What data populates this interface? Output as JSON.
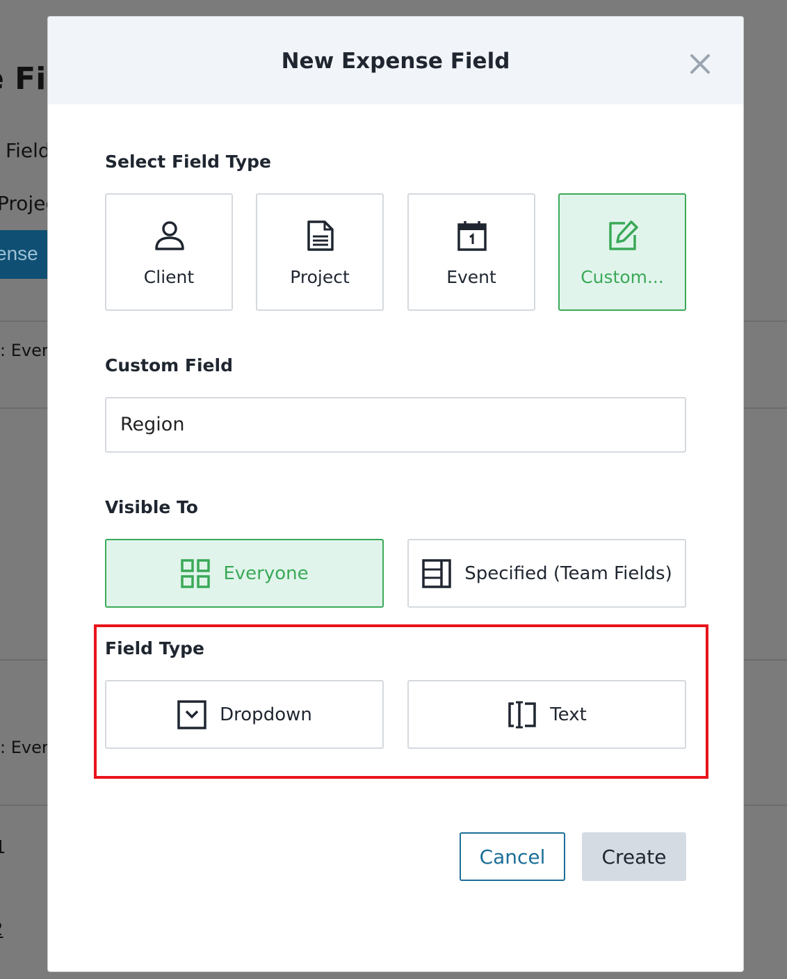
{
  "background": {
    "title_fragment": "e Fie",
    "field_fragment": "Field",
    "project_fragment": "Projec",
    "button_fragment": "ense",
    "every_fragment_1": ": Every",
    "every_fragment_2": ": Every",
    "num_1": "1",
    "num_2": "2"
  },
  "modal": {
    "title": "New Expense Field",
    "select_field_type_label": "Select Field Type",
    "field_types": [
      {
        "label": "Client",
        "icon": "user-icon",
        "selected": false
      },
      {
        "label": "Project",
        "icon": "document-icon",
        "selected": false
      },
      {
        "label": "Event",
        "icon": "calendar-icon",
        "selected": false
      },
      {
        "label": "Custom...",
        "icon": "edit-icon",
        "selected": true
      }
    ],
    "custom_field_label": "Custom Field",
    "custom_field_value": "Region",
    "visible_to_label": "Visible To",
    "visible_to": [
      {
        "label": "Everyone",
        "icon": "grid-icon",
        "selected": true
      },
      {
        "label": "Specified (Team Fields)",
        "icon": "layout-icon",
        "selected": false
      }
    ],
    "field_type_label": "Field Type",
    "field_type_options": [
      {
        "label": "Dropdown",
        "icon": "dropdown-icon"
      },
      {
        "label": "Text",
        "icon": "text-cursor-icon"
      }
    ],
    "cancel_label": "Cancel",
    "create_label": "Create"
  },
  "colors": {
    "accent_green": "#3aa957",
    "selected_bg": "#e1f4ec",
    "cancel_blue": "#1b6e98",
    "highlight_red": "#e8141b"
  }
}
